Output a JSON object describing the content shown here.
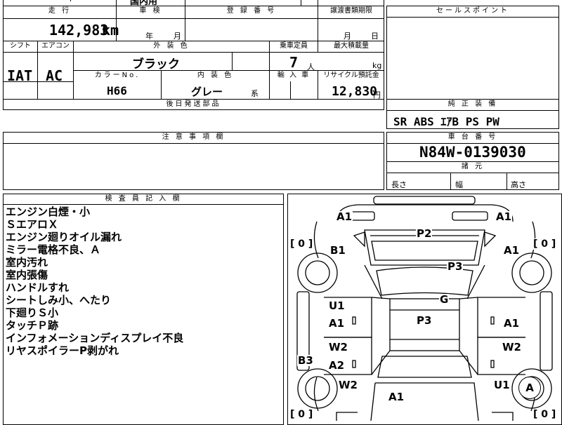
{
  "top_fragment": "国内用",
  "mileage": {
    "header": "走 行",
    "value": "142,983",
    "unit": "km"
  },
  "inspection": {
    "header": "車 検",
    "year": "年",
    "month": "月"
  },
  "registration": {
    "header": "登 録 番 号"
  },
  "transfer": {
    "header": "譲渡書類期限",
    "month": "月",
    "day": "日"
  },
  "shift": {
    "header": "シフト",
    "value": "IAT"
  },
  "aircon": {
    "header": "エアコン",
    "value": "AC"
  },
  "exterior": {
    "header": "外 装 色",
    "value": "ブラック"
  },
  "capacity": {
    "header": "乗車定員",
    "value": "7",
    "unit": "人"
  },
  "max_load": {
    "header": "最大積載量",
    "unit": "kg"
  },
  "color_no": {
    "header": "カラーNo.",
    "value": "H66"
  },
  "interior": {
    "header": "内 装 色",
    "value": "グレー",
    "suffix": "系"
  },
  "import_car": {
    "header": "輸 入 車"
  },
  "recycle": {
    "header": "リサイクル預託金",
    "value": "12,830",
    "unit": "円"
  },
  "later_parts": {
    "header": "後日発送部品"
  },
  "sales_point": {
    "header": "セールスポイント"
  },
  "equipment": {
    "header": "純 正 装 備",
    "value": "SR ABS ｴｱB PS PW"
  },
  "notes": {
    "header": "注 意 事 項 欄"
  },
  "chassis": {
    "header": "車 台 番 号",
    "value": "N84W-0139030"
  },
  "specs": {
    "header": "諸 元",
    "length": "長さ",
    "width": "幅",
    "height": "高さ"
  },
  "inspector": {
    "header": "検 査 員 記 入 欄",
    "remarks": [
      "エンジン白煙・小",
      "ＳエアロＸ",
      "エンジン廻りオイル漏れ",
      "ミラー電格不良、Ａ",
      "室内汚れ",
      "室内張傷",
      "ハンドルすれ",
      "シートしみ小、へたり",
      "下廻りＳ小",
      "タッチＰ跡",
      "インフォメーションディスプレイ不良",
      "リヤスポイラーP剥がれ"
    ]
  },
  "diagram": {
    "labels": [
      "A1",
      "A1",
      "P2",
      "B1",
      "A1",
      "P3",
      "G",
      "U1",
      "A1",
      "P3",
      "A1",
      "W2",
      "W2",
      "B3",
      "A2",
      "W2",
      "A1",
      "U1",
      "A"
    ],
    "tire_left_top": "[ 0 ]",
    "tire_right_top": "[ 0 ]",
    "tire_left_bottom": "[ 0 ]",
    "tire_right_bottom": "[ 0 ]"
  }
}
